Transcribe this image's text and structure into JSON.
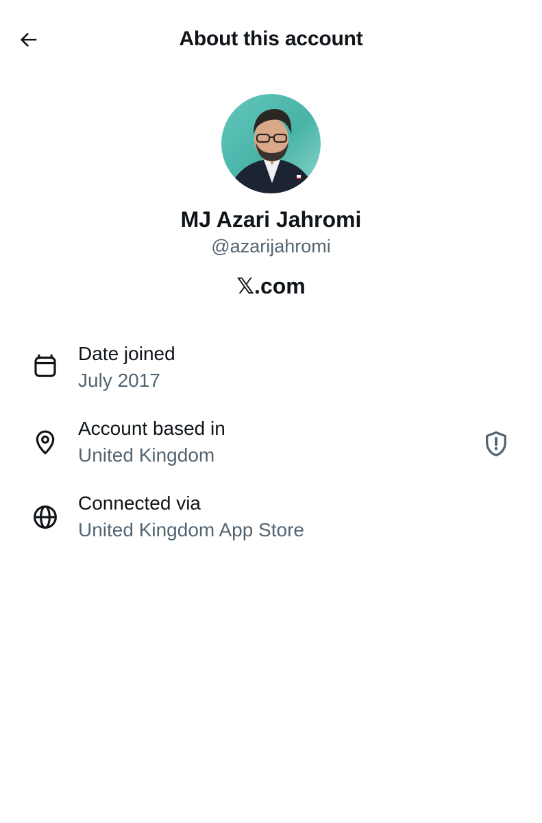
{
  "header": {
    "title": "About this account",
    "back_icon": "arrow-left-icon"
  },
  "profile": {
    "name": "MJ Azari Jahromi",
    "handle": "@azarijahromi",
    "site": "𝕏.com"
  },
  "info_rows": [
    {
      "icon": "calendar-icon",
      "title": "Date joined",
      "value": "July 2017"
    },
    {
      "icon": "location-pin-icon",
      "title": "Account based in",
      "value": "United Kingdom",
      "badge_icon": "shield-alert-icon"
    },
    {
      "icon": "globe-icon",
      "title": "Connected via",
      "value": "United Kingdom App Store"
    }
  ],
  "colors": {
    "text_primary": "#0f1419",
    "text_secondary": "#536471",
    "background": "#ffffff"
  }
}
